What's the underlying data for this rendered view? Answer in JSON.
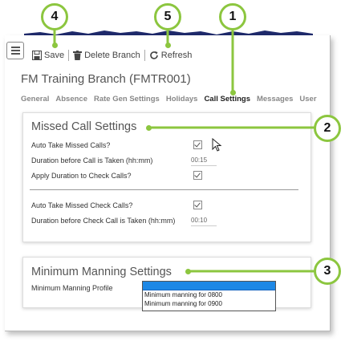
{
  "toolbar": {
    "save_label": "Save",
    "delete_label": "Delete Branch",
    "refresh_label": "Refresh"
  },
  "page": {
    "title": "FM Training Branch (FMTR001)"
  },
  "tabs": [
    {
      "label": "General",
      "active": false
    },
    {
      "label": "Absence",
      "active": false
    },
    {
      "label": "Rate Gen Settings",
      "active": false
    },
    {
      "label": "Holidays",
      "active": false
    },
    {
      "label": "Call Settings",
      "active": true
    },
    {
      "label": "Messages",
      "active": false
    },
    {
      "label": "User",
      "active": false
    }
  ],
  "missed_call": {
    "title": "Missed Call Settings",
    "auto_take_label": "Auto Take Missed Calls?",
    "auto_take_checked": true,
    "duration_label": "Duration before Call is Taken (hh:mm)",
    "duration_value": "00:15",
    "apply_duration_label": "Apply Duration to Check Calls?",
    "apply_duration_checked": true,
    "auto_take_check_label": "Auto Take Missed Check Calls?",
    "auto_take_check_checked": true,
    "check_duration_label": "Duration before Check Call is Taken (hh:mm)",
    "check_duration_value": "00:10"
  },
  "manning": {
    "title": "Minimum Manning Settings",
    "profile_label": "Minimum Manning Profile",
    "options": [
      "Minimum manning for 0800",
      "Minimum manning for 0900"
    ]
  },
  "callouts": [
    "4",
    "5",
    "1",
    "2",
    "3"
  ],
  "colors": {
    "callout_ring": "#8cc63f",
    "dropdown_highlight": "#1e88e5",
    "torn_edge": "#1f2a6b"
  },
  "icons": {
    "menu": "hamburger-icon",
    "save": "floppy-disk-icon",
    "delete": "trash-icon",
    "refresh": "refresh-icon",
    "cursor": "mouse-cursor-icon"
  }
}
